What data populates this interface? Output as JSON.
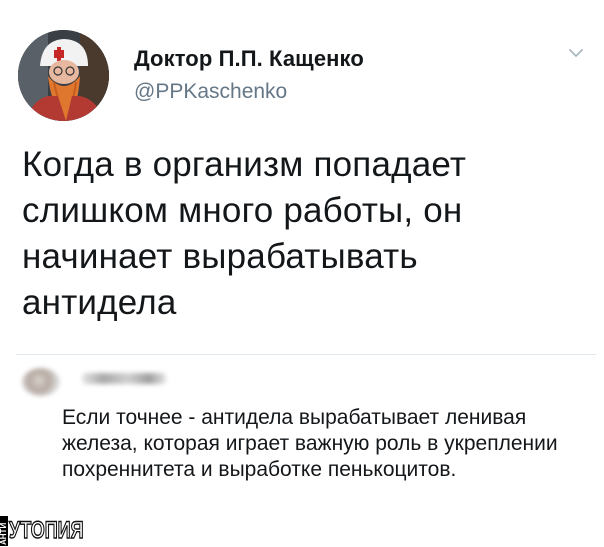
{
  "author": {
    "name": "Доктор П.П. Кащенко",
    "handle": "@PPKaschenko"
  },
  "tweet": {
    "text": "Когда в организм попадает слишком много работы, он начинает вырабатывать антидела"
  },
  "reply": {
    "text": "Если точнее - антидела вырабатывает ленивая железа, которая играет важную роль в укреплении похреннитета и выработке пенькоцитов."
  },
  "icons": {
    "menu": "chevron-down-icon",
    "avatar": "avatar",
    "reply_avatar": "avatar"
  },
  "watermark": {
    "small": "АНТИ",
    "text": "УТОПИЯ"
  },
  "colors": {
    "name": "#14171a",
    "handle": "#657786",
    "divider": "#e1e8ed"
  }
}
